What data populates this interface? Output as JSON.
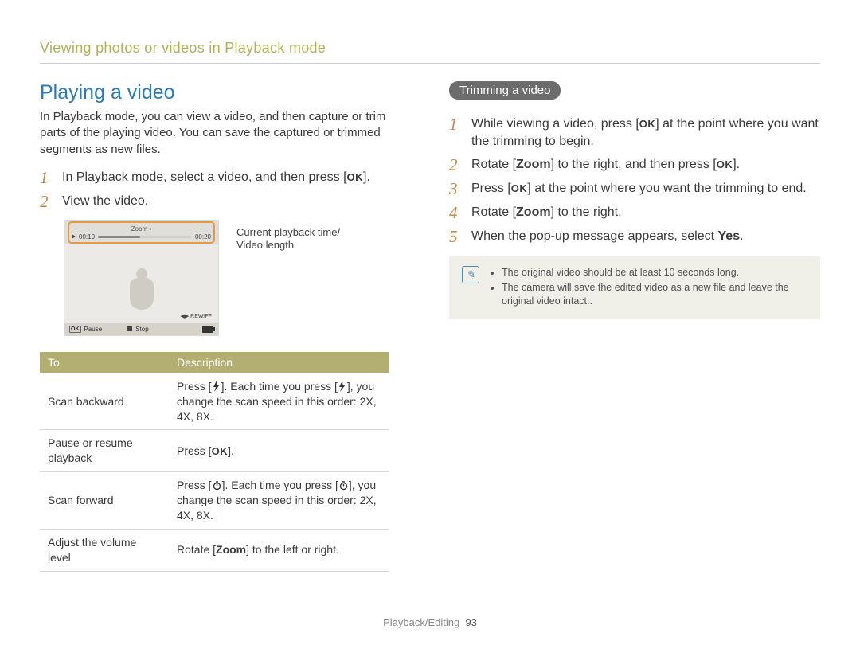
{
  "header": "Viewing photos or videos in Playback mode",
  "left": {
    "title": "Playing a video",
    "intro": "In Playback mode, you can view a video, and then capture or trim parts of the playing video. You can save the captured or trimmed segments as new files.",
    "step1_pre": "In Playback mode, select a video, and then press [",
    "step1_ok": "OK",
    "step1_post": "].",
    "step2": "View the video.",
    "callout": "Current playback time/\nVideo length",
    "shot": {
      "zoom": "Zoom ▪",
      "t_cur": "00:10",
      "t_len": "00:20",
      "rewff": "◀▶:REW/FF",
      "ok": "OK",
      "pause": "Pause",
      "stop": "Stop"
    },
    "table": {
      "h1": "To",
      "h2": "Description",
      "r1c1": "Scan backward",
      "r1c2_a": "Press [",
      "r1c2_b": "]. Each time you press [",
      "r1c2_c": "], you change the scan speed in this order: 2X, 4X, 8X.",
      "r2c1": "Pause or resume playback",
      "r2c2_a": "Press [",
      "r2c2_ok": "OK",
      "r2c2_b": "].",
      "r3c1": "Scan forward",
      "r3c2_a": "Press [",
      "r3c2_b": "]. Each time you press [",
      "r3c2_c": "], you change the scan speed in this order: 2X, 4X, 8X.",
      "r4c1": "Adjust the volume level",
      "r4c2_a": "Rotate [",
      "r4c2_zoom": "Zoom",
      "r4c2_b": "] to the left or right."
    }
  },
  "right": {
    "pill": "Trimming a video",
    "s1_a": "While viewing a video, press [",
    "s1_ok": "OK",
    "s1_b": "] at the point where you want the trimming to begin.",
    "s2_a": "Rotate [",
    "s2_zoom": "Zoom",
    "s2_b": "] to the right, and then press [",
    "s2_ok": "OK",
    "s2_c": "].",
    "s3_a": "Press [",
    "s3_ok": "OK",
    "s3_b": "] at the point where you want the trimming to end.",
    "s4_a": "Rotate [",
    "s4_zoom": "Zoom",
    "s4_b": "] to the right.",
    "s5_a": "When the pop-up message appears, select ",
    "s5_yes": "Yes",
    "s5_b": ".",
    "note1": "The original video should be at least 10 seconds long.",
    "note2": "The camera will save the edited video as a new file and leave the original video intact.."
  },
  "footer_section": "Playback/Editing",
  "footer_page": "93",
  "step_numbers": {
    "n1": "1",
    "n2": "2",
    "n3": "3",
    "n4": "4",
    "n5": "5"
  }
}
